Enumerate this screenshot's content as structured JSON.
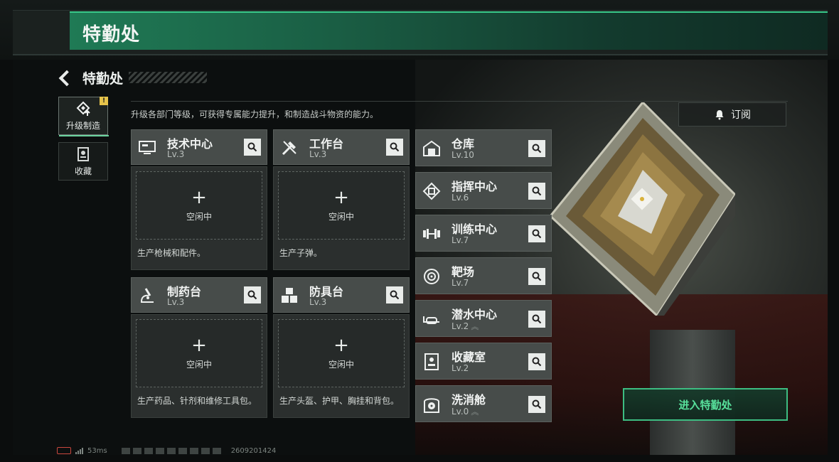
{
  "banner": {
    "title": "特勤处"
  },
  "header": {
    "title": "特勤处"
  },
  "description": "升级各部门等级，可获得专属能力提升，和制造战斗物资的能力。",
  "tabs": [
    {
      "label": "升级制造",
      "icon": "upgrade-icon",
      "active": true,
      "badge": "!"
    },
    {
      "label": "收藏",
      "icon": "collection-icon",
      "active": false
    }
  ],
  "subscribe": {
    "label": "订阅",
    "icon": "bell-icon"
  },
  "stations": [
    {
      "name": "技术中心",
      "level": "Lv.3",
      "icon": "tech-monitor-icon",
      "slot": "空闲中",
      "plus": "+",
      "desc": "生产枪械和配件。"
    },
    {
      "name": "工作台",
      "level": "Lv.3",
      "icon": "tools-icon",
      "slot": "空闲中",
      "plus": "+",
      "desc": "生产子弹。"
    },
    {
      "name": "制药台",
      "level": "Lv.3",
      "icon": "microscope-icon",
      "slot": "空闲中",
      "plus": "+",
      "desc": "生产药品、针剂和维修工具包。"
    },
    {
      "name": "防具台",
      "level": "Lv.3",
      "icon": "armor-boxes-icon",
      "slot": "空闲中",
      "plus": "+",
      "desc": "生产头盔、护甲、胸挂和背包。"
    }
  ],
  "departments": [
    {
      "name": "仓库",
      "level": "Lv.10",
      "icon": "warehouse-icon",
      "upgrade": ""
    },
    {
      "name": "指挥中心",
      "level": "Lv.6",
      "icon": "chip-icon",
      "upgrade": ""
    },
    {
      "name": "训练中心",
      "level": "Lv.7",
      "icon": "dumbbell-icon",
      "upgrade": ""
    },
    {
      "name": "靶场",
      "level": "Lv.7",
      "icon": "target-icon",
      "upgrade": ""
    },
    {
      "name": "潜水中心",
      "level": "Lv.2",
      "icon": "diving-mask-icon",
      "upgrade": "︽"
    },
    {
      "name": "收藏室",
      "level": "Lv.2",
      "icon": "display-case-icon",
      "upgrade": ""
    },
    {
      "name": "洗消舱",
      "level": "Lv.0",
      "icon": "radiation-icon",
      "upgrade": "︽"
    }
  ],
  "enter_button": {
    "label": "进入特勤处"
  },
  "footer": {
    "ping": "53ms",
    "id": "2609201424"
  },
  "colors": {
    "accent": "#3dbd82",
    "accent_text": "#58e09b",
    "card": "#474c4a",
    "badge": "#e6c34a"
  }
}
